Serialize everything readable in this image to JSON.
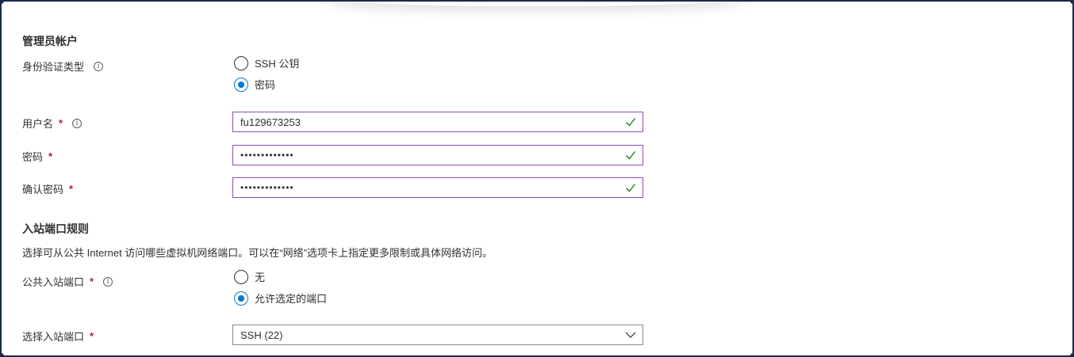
{
  "admin_section": {
    "title": "管理员帐户",
    "auth_type": {
      "label": "身份验证类型",
      "options": [
        "SSH 公钥",
        "密码"
      ],
      "selected": "密码"
    },
    "username": {
      "label": "用户名",
      "value": "fu129673253"
    },
    "password": {
      "label": "密码",
      "value": "•••••••••••••"
    },
    "confirm_password": {
      "label": "确认密码",
      "value": "•••••••••••••"
    }
  },
  "inbound_section": {
    "title": "入站端口规则",
    "description": "选择可从公共 Internet 访问哪些虚拟机网络端口。可以在“网络”选项卡上指定更多限制或具体网络访问。",
    "public_ports": {
      "label": "公共入站端口",
      "options": [
        "无",
        "允许选定的端口"
      ],
      "selected": "允许选定的端口"
    },
    "select_ports": {
      "label": "选择入站端口",
      "value": "SSH (22)"
    }
  },
  "required_marker": "*",
  "info_glyph": "i",
  "colors": {
    "accent": "#0078d4",
    "valid_border": "#8a4fb3",
    "check_green": "#107c10",
    "required_red": "#a4262c"
  }
}
